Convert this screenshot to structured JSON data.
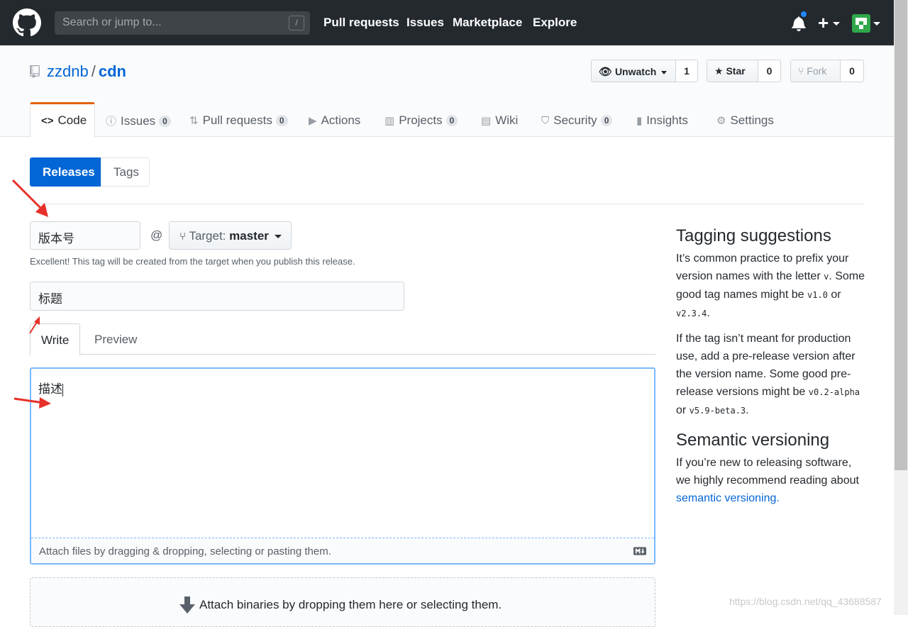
{
  "header": {
    "search_placeholder": "Search or jump to...",
    "search_shortcut": "/",
    "nav": [
      "Pull requests",
      "Issues",
      "Marketplace",
      "Explore"
    ],
    "plus": "+"
  },
  "repo": {
    "owner": "zzdnb",
    "separator": "/",
    "name": "cdn",
    "unwatch_label": "Unwatch",
    "unwatch_count": "1",
    "star_label": "Star",
    "star_count": "0",
    "fork_label": "Fork",
    "fork_count": "0"
  },
  "tabs": [
    {
      "label": "Code",
      "badge": ""
    },
    {
      "label": "Issues",
      "badge": "0"
    },
    {
      "label": "Pull requests",
      "badge": "0"
    },
    {
      "label": "Actions",
      "badge": ""
    },
    {
      "label": "Projects",
      "badge": "0"
    },
    {
      "label": "Wiki",
      "badge": ""
    },
    {
      "label": "Security",
      "badge": "0"
    },
    {
      "label": "Insights",
      "badge": ""
    },
    {
      "label": "Settings",
      "badge": ""
    }
  ],
  "subnav": {
    "releases": "Releases",
    "tags": "Tags"
  },
  "form": {
    "tag_value": "版本号",
    "at": "@",
    "target_prefix": "Target:",
    "target_branch": "master",
    "tag_note": "Excellent! This tag will be created from the target when you publish this release.",
    "title_value": "标题",
    "write_tab": "Write",
    "preview_tab": "Preview",
    "description_value": "描述",
    "attach_hint": "Attach files by dragging & dropping, selecting or pasting them.",
    "binaries_hint": "Attach binaries by dropping them here or selecting them."
  },
  "sidebar": {
    "tagging_title": "Tagging suggestions",
    "p1_a": "It’s common practice to prefix your version names with the letter ",
    "p1_code1": "v",
    "p1_b": ". Some good tag names might be ",
    "p1_code2": "v1.0",
    "p1_c": " or ",
    "p1_code3": "v2.3.4",
    "p1_d": ".",
    "p2_a": "If the tag isn’t meant for production use, add a pre-release version after the version name. Some good pre-release versions might be ",
    "p2_code1": "v0.2-alpha",
    "p2_b": " or ",
    "p2_code2": "v5.9-beta.3",
    "p2_c": ".",
    "semver_title": "Semantic versioning",
    "p3_a": "If you’re new to releasing software, we highly recommend reading about ",
    "p3_link": "semantic versioning.",
    "watermark": "https://blog.csdn.net/qq_43688587"
  },
  "colors": {
    "accent": "#0366d6",
    "header_bg": "#24292e",
    "selected_tab": "#e36209",
    "annotation": "#e8302a"
  }
}
